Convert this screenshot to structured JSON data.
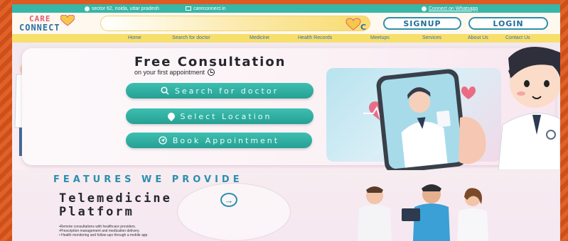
{
  "topbar": {
    "location": "sector 62, noida, uttar pradesh",
    "email": "careconnect.in",
    "whatsapp": "Connect on Whatsapp"
  },
  "header": {
    "logo_line1": "CARE",
    "logo_line2": "CONNECT",
    "signup_label": "SIGNUP",
    "login_label": "LOGIN"
  },
  "nav": {
    "items": [
      "Home",
      "Search for doctor",
      "Medicine",
      "Health Records",
      "Meetups",
      "Services",
      "About Us",
      "Contact Us"
    ]
  },
  "hero": {
    "title": "Free Consultation",
    "subtitle": "on your first appointment",
    "cta_search": "Search for doctor",
    "cta_location": "Select Location",
    "cta_book": "Book Appointment"
  },
  "features": {
    "heading": "FEATURES WE PROVIDE",
    "title_line1": "Telemedicine",
    "title_line2": "Platform",
    "bullets": [
      "•Remote consultations with healthcare providers.",
      "•Prescription management and medication delivery.",
      "• Health monitoring and follow-ups through a mobile app"
    ]
  },
  "colors": {
    "teal": "#38b6a8",
    "nav_yellow": "#f7df6b",
    "frame_orange": "#d9541e",
    "brand_blue": "#2c6fa6"
  }
}
